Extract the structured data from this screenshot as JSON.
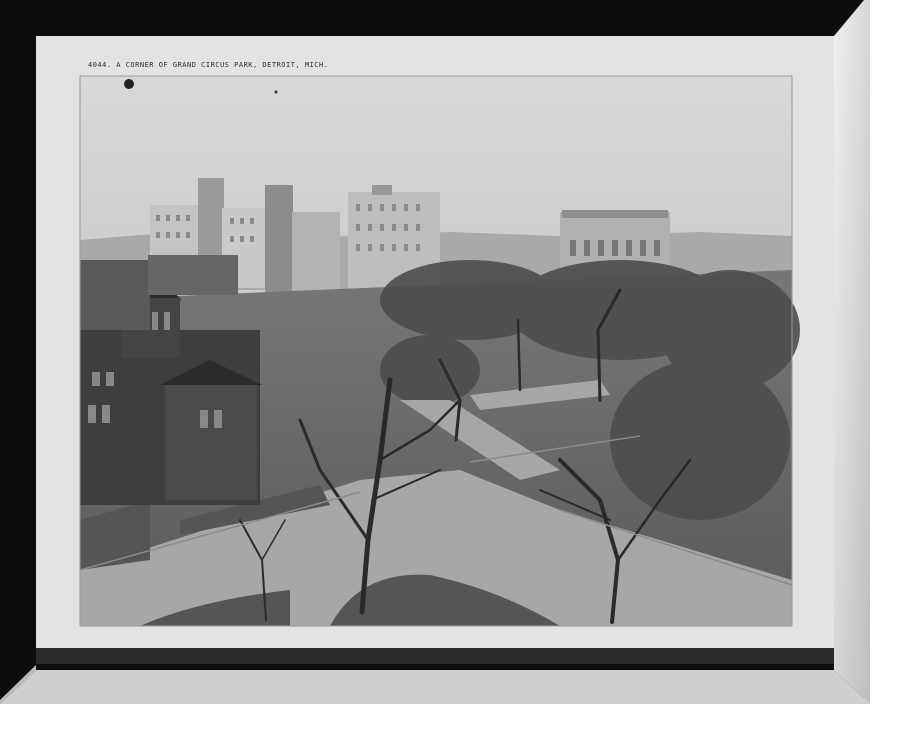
{
  "photo": {
    "caption": "4044. A CORNER OF GRAND CIRCUS PARK, DETROIT, MICH."
  },
  "colors": {
    "frame_outer": "#0c0c0c",
    "frame_bevel": "#d3d3d3",
    "mat": "#e4e4e4",
    "sky": "#cdcdcd",
    "ground": "#6e6e6e",
    "trees": "#4a4a4a"
  }
}
